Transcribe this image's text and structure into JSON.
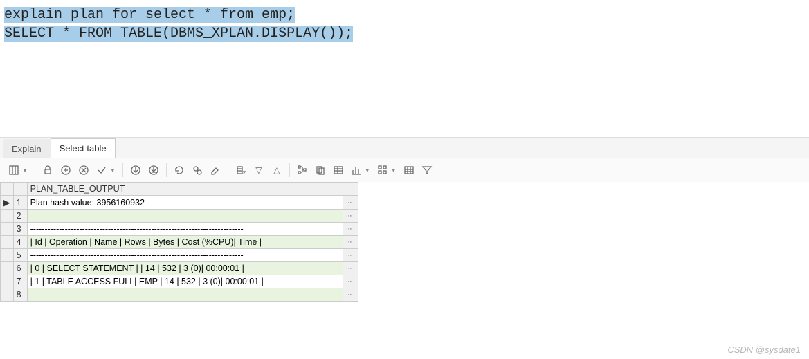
{
  "editor": {
    "line1": "explain plan for select * from emp;",
    "line2": "SELECT * FROM TABLE(DBMS_XPLAN.DISPLAY());"
  },
  "tabs": {
    "inactive": "Explain",
    "active": "Select table"
  },
  "grid": {
    "header": "PLAN_TABLE_OUTPUT",
    "rows": [
      {
        "n": "1",
        "text": "Plan hash value: 3956160932"
      },
      {
        "n": "2",
        "text": ""
      },
      {
        "n": "3",
        "text": "--------------------------------------------------------------------------"
      },
      {
        "n": "4",
        "text": "| Id  | Operation         | Name | Rows  | Bytes | Cost (%CPU)| Time     |"
      },
      {
        "n": "5",
        "text": "--------------------------------------------------------------------------"
      },
      {
        "n": "6",
        "text": "|   0 | SELECT STATEMENT  |      |    14 |   532 |     3   (0)| 00:00:01 |"
      },
      {
        "n": "7",
        "text": "|   1 |  TABLE ACCESS FULL| EMP  |    14 |   532 |     3   (0)| 00:00:01 |"
      },
      {
        "n": "8",
        "text": "--------------------------------------------------------------------------"
      }
    ],
    "ellipsis": "···"
  },
  "watermark": "CSDN @sysdate1"
}
